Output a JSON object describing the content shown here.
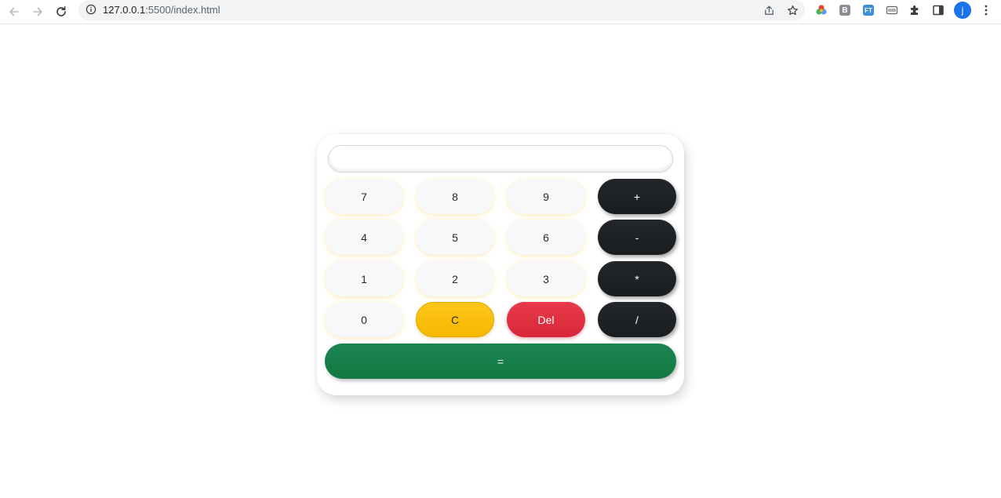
{
  "browser": {
    "url_host": "127.0.0.1",
    "url_path": ":5500/index.html",
    "profile_initial": "j",
    "toolbar_icons": [
      "back-icon",
      "forward-icon",
      "reload-icon",
      "site-info-icon",
      "share-icon",
      "bookmark-star-icon",
      "color-wheel-extension-icon",
      "b-extension-icon",
      "ft-extension-icon",
      "keyboard-extension-icon",
      "extensions-puzzle-icon",
      "side-panel-icon",
      "menu-kebab-icon"
    ],
    "extensions": {
      "b_label": "B",
      "ft_label": "FT"
    }
  },
  "calculator": {
    "display_value": "",
    "rows": [
      [
        {
          "label": "7"
        },
        {
          "label": "8"
        },
        {
          "label": "9"
        },
        {
          "label": "+"
        }
      ],
      [
        {
          "label": "4"
        },
        {
          "label": "5"
        },
        {
          "label": "6"
        },
        {
          "label": "-"
        }
      ],
      [
        {
          "label": "1"
        },
        {
          "label": "2"
        },
        {
          "label": "3"
        },
        {
          "label": "*"
        }
      ],
      [
        {
          "label": "0"
        },
        {
          "label": "C"
        },
        {
          "label": "Del"
        },
        {
          "label": "/"
        }
      ]
    ],
    "equals_label": "=",
    "colors": {
      "operator": "#1e2124",
      "clear": "#ffc107",
      "delete": "#dc3545",
      "equals": "#198754",
      "number": "#f8f9fa"
    }
  }
}
